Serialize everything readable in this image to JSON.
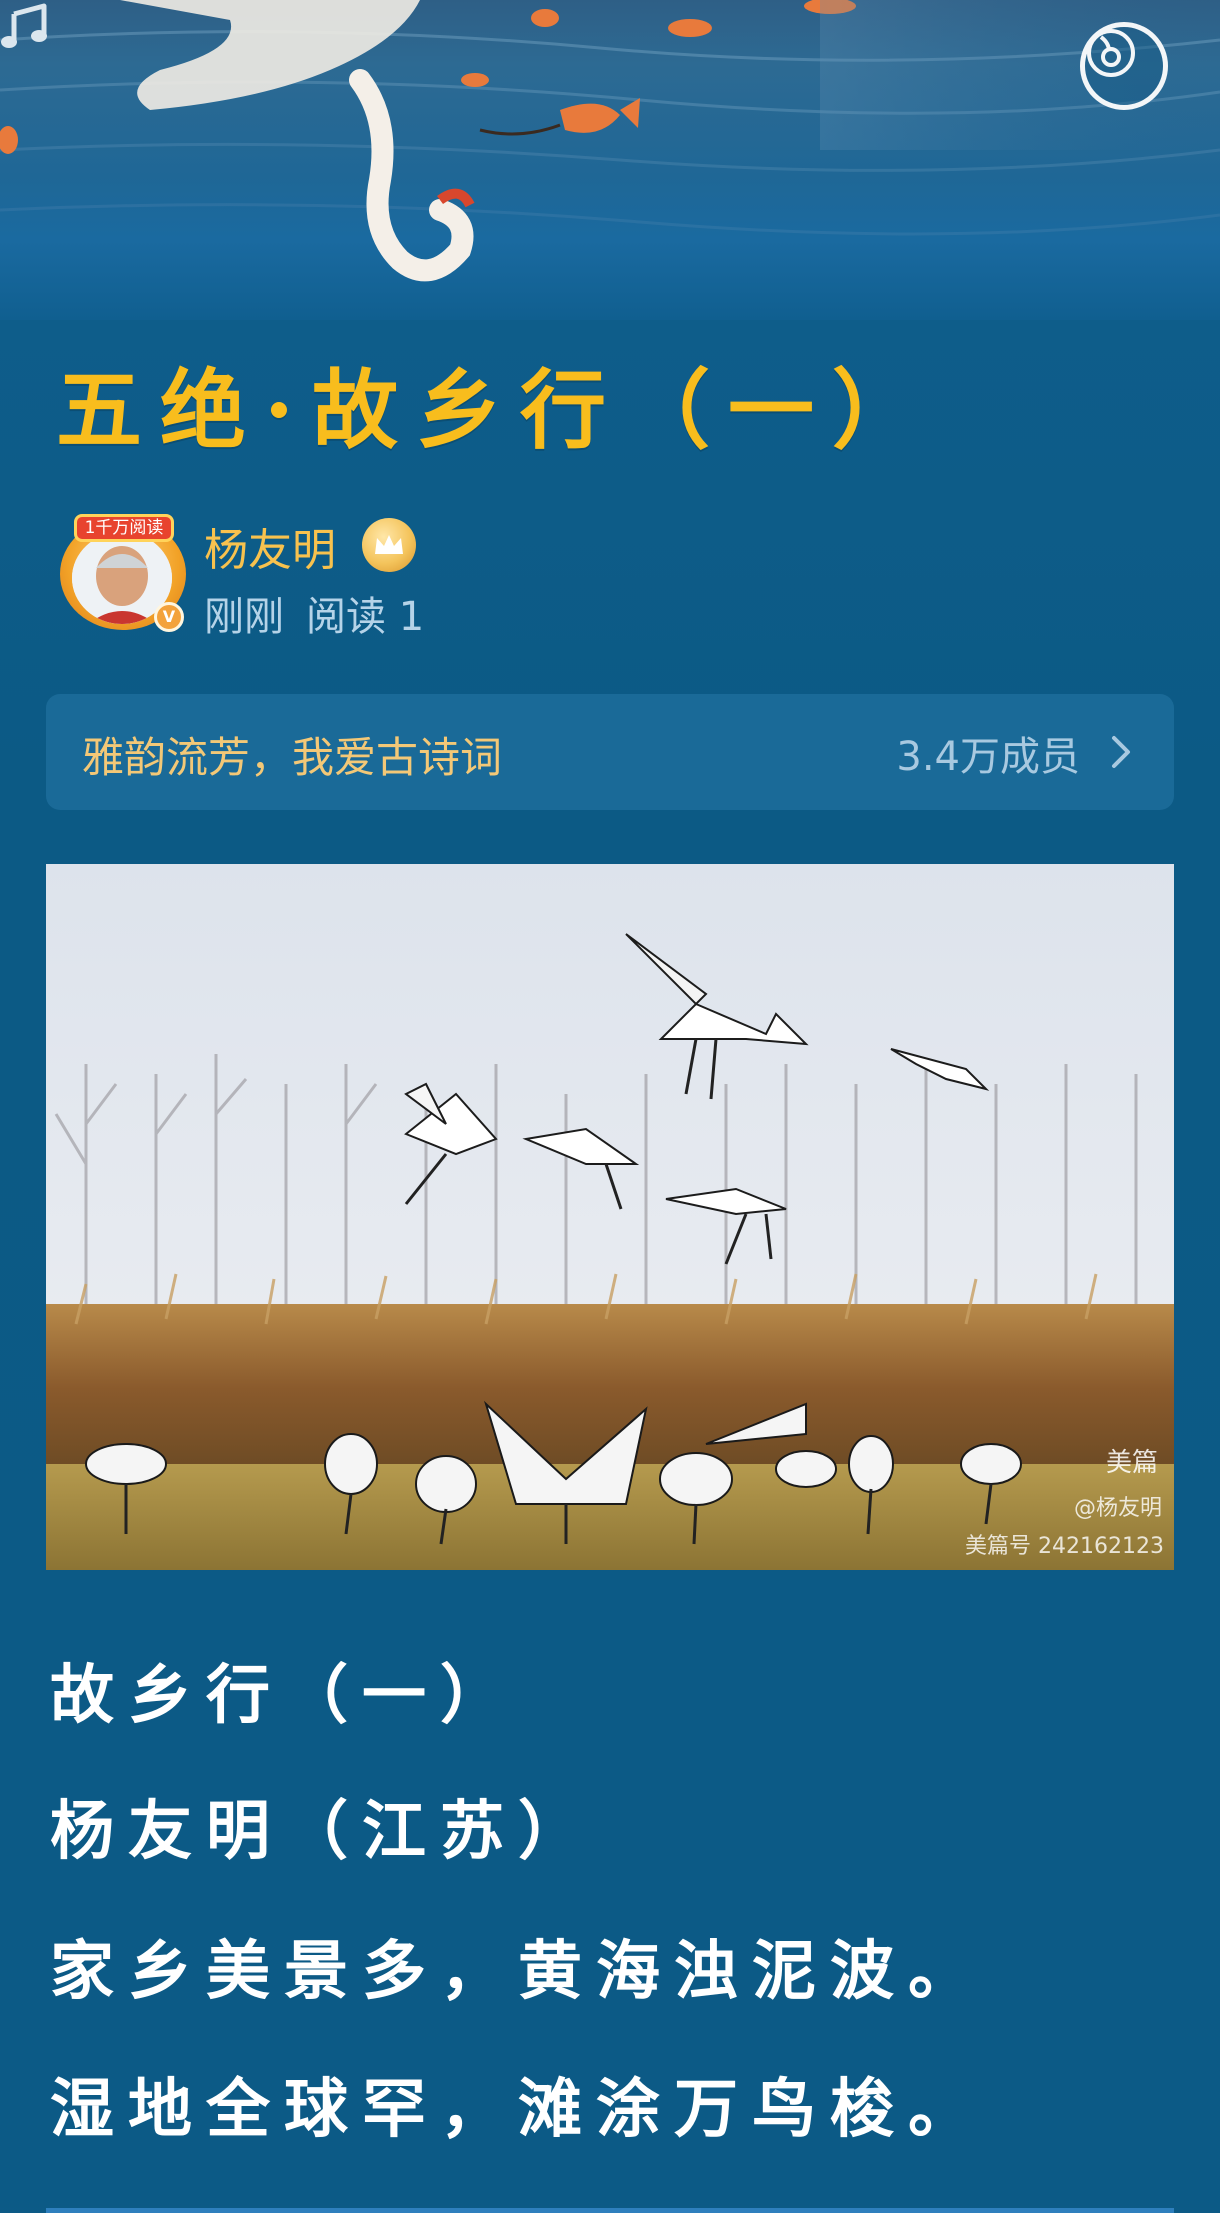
{
  "header": {
    "disc_icon": "music-disc-icon",
    "note_icon": "music-note-icon"
  },
  "title": "五绝·故乡行（一）",
  "author": {
    "name": "杨友明",
    "badge": "1千万阅读",
    "verified_mark": "V",
    "time": "刚刚",
    "read_label": "阅读 1"
  },
  "community": {
    "name": "雅韵流芳，我爱古诗词",
    "members": "3.4万成员"
  },
  "photo": {
    "watermark_brand": "美篇",
    "watermark_author": "@杨友明",
    "watermark_id": "美篇号 242162123"
  },
  "poem": {
    "lines": [
      "故乡行（一）",
      "杨友明（江苏）",
      "家乡美景多，黄海浊泥波。",
      "湿地全球罕，滩涂万鸟梭。"
    ]
  },
  "colors": {
    "background": "#0c5a86",
    "title": "#f8bd1d",
    "author": "#f8c24e",
    "community_text": "#f3c877"
  }
}
